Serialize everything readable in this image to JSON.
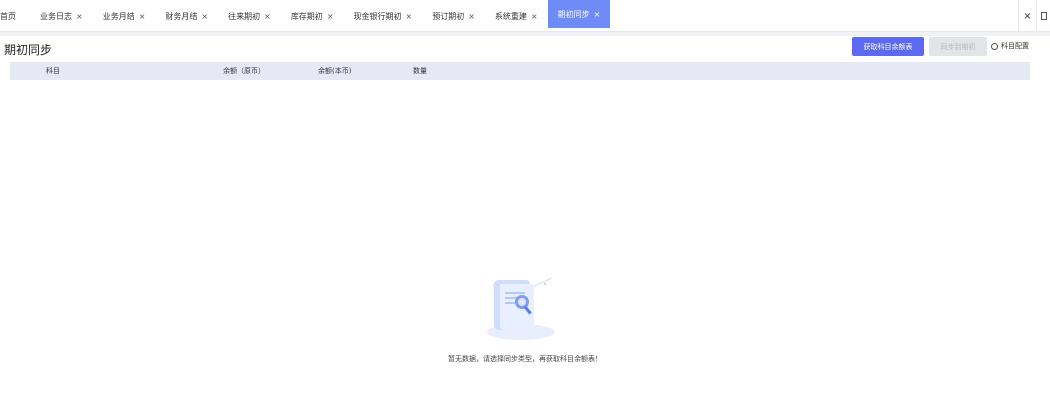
{
  "tabs": [
    {
      "label": "首页",
      "closable": false,
      "active": false
    },
    {
      "label": "业务日志",
      "closable": true,
      "active": false
    },
    {
      "label": "业务月结",
      "closable": true,
      "active": false
    },
    {
      "label": "财务月结",
      "closable": true,
      "active": false
    },
    {
      "label": "往来期初",
      "closable": true,
      "active": false
    },
    {
      "label": "库存期初",
      "closable": true,
      "active": false
    },
    {
      "label": "现金银行期初",
      "closable": true,
      "active": false
    },
    {
      "label": "预订期初",
      "closable": true,
      "active": false
    },
    {
      "label": "系统重建",
      "closable": true,
      "active": false
    },
    {
      "label": "期初同步",
      "closable": true,
      "active": true
    }
  ],
  "tabbar": {
    "close_all": "×"
  },
  "page": {
    "title": "期初同步",
    "fetch_button": "获取科目余额表",
    "sync_button": "同步到期初",
    "config_link": "科目配置"
  },
  "table": {
    "columns": [
      "科目",
      "余额（原币）",
      "余额(本币)",
      "数量"
    ]
  },
  "empty": {
    "message": "暂无数据，请选择同步类型，再获取科目余额表！"
  },
  "colors": {
    "accent": "#5b6af0",
    "active_tab": "#6f8bf6",
    "table_header": "#e6e9f4"
  }
}
